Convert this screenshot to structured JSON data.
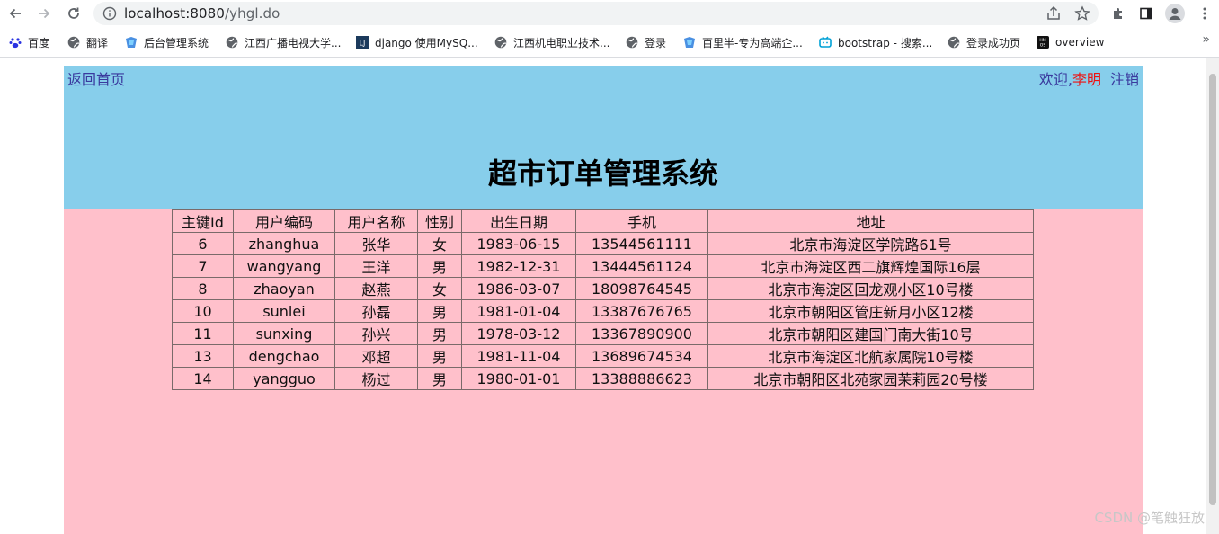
{
  "browser": {
    "url_host": "localhost:8080",
    "url_path": "/yhgl.do",
    "bookmarks": [
      {
        "label": "百度",
        "icon": "baidu-paw-icon"
      },
      {
        "label": "翻译",
        "icon": "globe-icon"
      },
      {
        "label": "后台管理系统",
        "icon": "bookmark-app-icon"
      },
      {
        "label": "江西广播电视大学...",
        "icon": "globe-icon"
      },
      {
        "label": "django 使用MySQ...",
        "icon": "lj-icon"
      },
      {
        "label": "江西机电职业技术...",
        "icon": "globe-icon"
      },
      {
        "label": "登录",
        "icon": "globe-icon"
      },
      {
        "label": "百里半-专为高端企...",
        "icon": "bookmark-app-icon"
      },
      {
        "label": "bootstrap - 搜索...",
        "icon": "tv-icon"
      },
      {
        "label": "登录成功页",
        "icon": "globe-icon"
      },
      {
        "label": "overview",
        "icon": "harmony-os-icon"
      }
    ],
    "bookmarks_more": "»"
  },
  "header": {
    "home_link": "返回首页",
    "welcome_prefix": "欢迎,",
    "username": "李明",
    "logout": "注销",
    "title": "超市订单管理系统"
  },
  "table": {
    "columns": [
      "主键Id",
      "用户编码",
      "用户名称",
      "性别",
      "出生日期",
      "手机",
      "地址"
    ],
    "rows": [
      [
        "6",
        "zhanghua",
        "张华",
        "女",
        "1983-06-15",
        "13544561111",
        "北京市海淀区学院路61号"
      ],
      [
        "7",
        "wangyang",
        "王洋",
        "男",
        "1982-12-31",
        "13444561124",
        "北京市海淀区西二旗辉煌国际16层"
      ],
      [
        "8",
        "zhaoyan",
        "赵燕",
        "女",
        "1986-03-07",
        "18098764545",
        "北京市海淀区回龙观小区10号楼"
      ],
      [
        "10",
        "sunlei",
        "孙磊",
        "男",
        "1981-01-04",
        "13387676765",
        "北京市朝阳区管庄新月小区12楼"
      ],
      [
        "11",
        "sunxing",
        "孙兴",
        "男",
        "1978-03-12",
        "13367890900",
        "北京市朝阳区建国门南大街10号"
      ],
      [
        "13",
        "dengchao",
        "邓超",
        "男",
        "1981-11-04",
        "13689674534",
        "北京市海淀区北航家属院10号楼"
      ],
      [
        "14",
        "yangguo",
        "杨过",
        "男",
        "1980-01-01",
        "13388886623",
        "北京市朝阳区北苑家园茉莉园20号楼"
      ]
    ]
  },
  "watermark": "CSDN @笔触狂放",
  "colors": {
    "header_bg": "#87ceeb",
    "content_bg": "#ffc0cb",
    "link": "#3a3a9e",
    "username": "#ee1111"
  }
}
